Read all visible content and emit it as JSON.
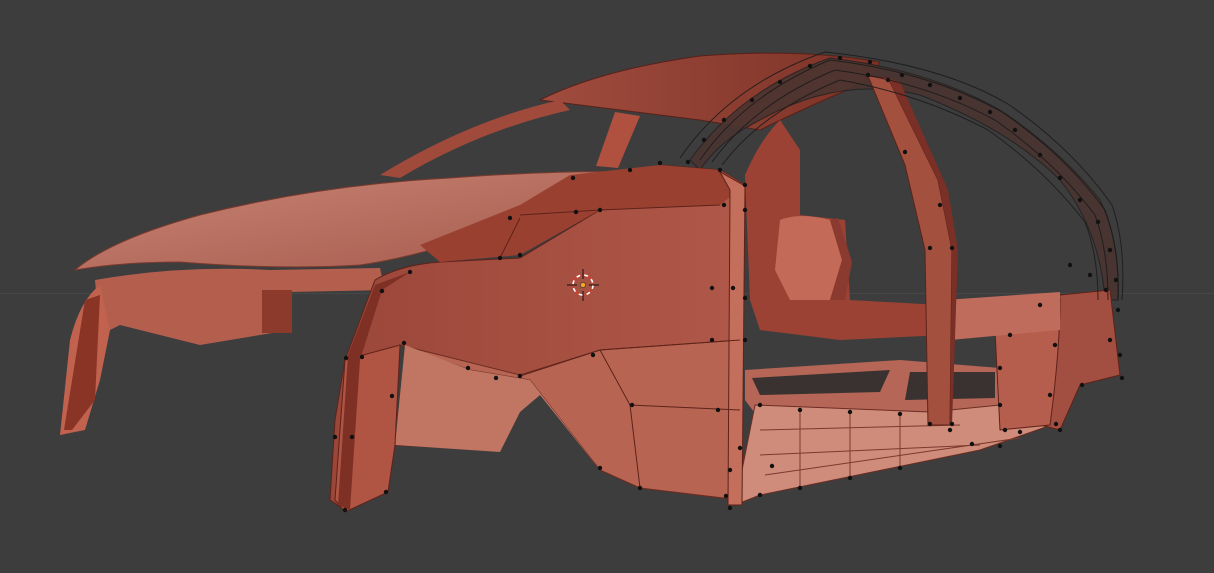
{
  "viewport": {
    "background": "#3d3d3d",
    "mode": "edit-mode",
    "object": "car-body-mesh"
  },
  "colors": {
    "body": "#a85244",
    "body_light": "#c8786a",
    "body_dark": "#7a3026",
    "body_shadow": "#5e2219",
    "floor_dark": "#3a3230",
    "vertex": "#111111",
    "cursor_ring_a": "#ffffff",
    "cursor_ring_b": "#d63c2c",
    "object_origin": "#f5a623"
  },
  "icons": {
    "cursor": "3d-cursor-icon",
    "origin": "object-origin-icon"
  }
}
